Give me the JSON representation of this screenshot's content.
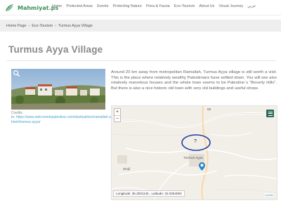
{
  "header": {
    "logo_text": "Mahmiyat.ps",
    "nav": [
      "Home",
      "Protected Areas",
      "Events",
      "Protecting Nature",
      "Flora & Fauna",
      "Eco-Tourism",
      "About Us",
      "Visual Journey",
      "عربي"
    ]
  },
  "breadcrumb": {
    "home": "Home Page",
    "section": "Eco-Tourism",
    "current": "Turmus Ayya Village",
    "separator": "›"
  },
  "page": {
    "title": "Turmus Ayya Village"
  },
  "photo": {
    "zoom_icon": "magnifier-icon",
    "credits_label": "Credits",
    "credits_link": "to: https://www.welcometopalestine.com/destinations/ramallah-al-bireh/turmus-ayya/"
  },
  "description": "Around 20 km away from metropolitan Ramallah, Turmus Ayya village is still worth a visit. This is the place where relatively wealthy Palestinians have settled down. You will see also relatively marvelous houses and the whole town seems to be Palestine`s \"Beverly Hills\". But there is also a nice historic old town with very old buildings and useful shops.",
  "map": {
    "zoom_in": "+",
    "zoom_out": "−",
    "labels": {
      "sinjil": "Sinjil",
      "turmus_ayya": "Turmus Ayya",
      "road_60": "60"
    },
    "coordinates": "Longitude: 35.3001145 , Latitude: 32.0254092",
    "attribution": "Leaflet",
    "question_mark": "?",
    "colors": {
      "ellipse": "#1f3f9f",
      "marker": "#2a86c9",
      "water": "#aad3df"
    }
  }
}
